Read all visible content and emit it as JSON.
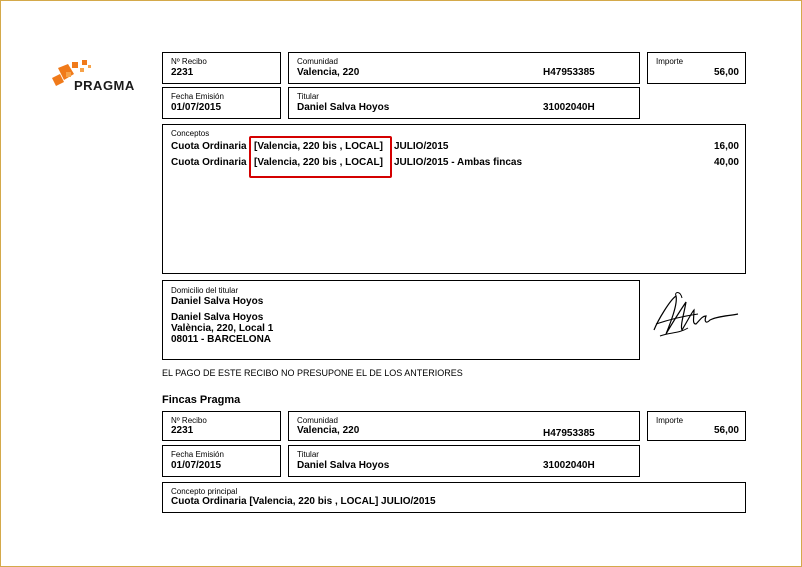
{
  "logo": {
    "text": "PRAGMA",
    "accent_color": "#f07a1a"
  },
  "receipt": {
    "n_recibo_label": "Nº Recibo",
    "n_recibo": "2231",
    "comunidad_label": "Comunidad",
    "comunidad": "Valencia, 220",
    "comunidad_code": "H47953385",
    "importe_label": "Importe",
    "importe": "56,00",
    "fecha_label": "Fecha Emisión",
    "fecha": "01/07/2015",
    "titular_label": "Titular",
    "titular": "Daniel Salva Hoyos",
    "titular_code": "31002040H"
  },
  "conceptos": {
    "label": "Conceptos",
    "items": [
      {
        "prefix": "Cuota Ordinaria",
        "location": "[Valencia, 220 bis , LOCAL]",
        "suffix": "JULIO/2015",
        "amount": "16,00"
      },
      {
        "prefix": "Cuota Ordinaria",
        "location": "[Valencia, 220 bis , LOCAL]",
        "suffix": "JULIO/2015 - Ambas fincas",
        "amount": "40,00"
      }
    ]
  },
  "domicilio": {
    "label": "Domicilio del titular",
    "name": "Daniel Salva Hoyos",
    "addr_name": "Daniel Salva Hoyos",
    "addr_line1": "València, 220, Local 1",
    "addr_line2": "08011 - BARCELONA"
  },
  "notice": "EL PAGO DE ESTE RECIBO NO PRESUPONE EL DE LOS ANTERIORES",
  "stub": {
    "title": "Fincas Pragma",
    "n_recibo_label": "Nº Recibo",
    "n_recibo": "2231",
    "comunidad_label": "Comunidad",
    "comunidad": "Valencia, 220",
    "comunidad_code": "H47953385",
    "importe_label": "Importe",
    "importe": "56,00",
    "fecha_label": "Fecha Emisión",
    "fecha": "01/07/2015",
    "titular_label": "Titular",
    "titular": "Daniel Salva Hoyos",
    "titular_code": "31002040H",
    "concepto_label": "Concepto principal",
    "concepto": "Cuota Ordinaria [Valencia, 220 bis , LOCAL] JULIO/2015"
  }
}
